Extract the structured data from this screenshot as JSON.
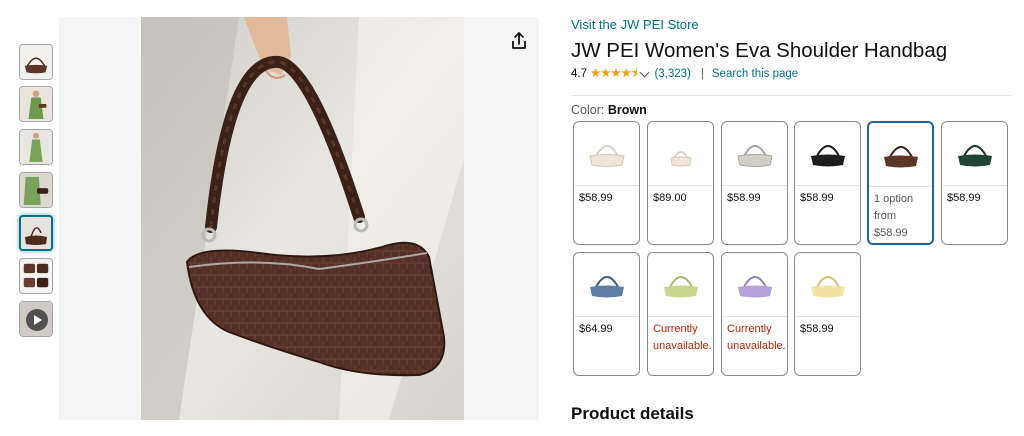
{
  "gallery": {
    "thumbnails": [
      {
        "icon": "handbag-thumbnail",
        "kind": "image"
      },
      {
        "icon": "model-green-dress-thumbnail",
        "kind": "image"
      },
      {
        "icon": "model-green-dress-side-thumbnail",
        "kind": "image"
      },
      {
        "icon": "model-holding-bag-thumbnail",
        "kind": "image"
      },
      {
        "icon": "handbag-hand-thumbnail",
        "kind": "image",
        "selected": true
      },
      {
        "icon": "handbag-details-thumbnail",
        "kind": "image"
      },
      {
        "icon": "video-play-thumbnail",
        "kind": "video"
      }
    ],
    "share_icon": "share-icon"
  },
  "product": {
    "store_link": "Visit the JW PEI Store",
    "title": "JW PEI Women's Eva Shoulder Handbag",
    "rating_value": "4.7",
    "stars": "★★★★⯨",
    "rating_count": "(3,323)",
    "separator": "|",
    "search_link": "Search this page"
  },
  "color": {
    "label": "Color:",
    "value": "Brown",
    "options": [
      {
        "name": "Cream",
        "price": "$58.99",
        "color": "#ece6da",
        "available": true
      },
      {
        "name": "Ivory Crystal",
        "price": "$89.00",
        "color": "#efe6d9",
        "available": true
      },
      {
        "name": "Light Grey",
        "price": "$58.99",
        "color": "#d4cfc6",
        "available": true
      },
      {
        "name": "Black",
        "price": "$58.99",
        "color": "#1e1e1e",
        "available": true
      },
      {
        "name": "Brown",
        "price_line1": "1 option",
        "price_line2": "from",
        "price_line3": "$58.99",
        "color": "#5c3526",
        "available": true,
        "selected": true
      },
      {
        "name": "Dark Green",
        "price": "$58.99",
        "color": "#214534",
        "available": true
      },
      {
        "name": "Denim Blue",
        "price": "$64.99",
        "color": "#5d7fa5",
        "available": true
      },
      {
        "name": "Light Green",
        "price_line1": "Currently",
        "price_line2": "unavailable.",
        "color": "#c7d68f",
        "available": false
      },
      {
        "name": "Lilac",
        "price_line1": "Currently",
        "price_line2": "unavailable.",
        "color": "#b6a1d8",
        "available": false
      },
      {
        "name": "Butter Yellow",
        "price": "$58.99",
        "color": "#f0e3a2",
        "available": true
      }
    ]
  },
  "section": {
    "product_details": "Product details"
  },
  "colors": {
    "link": "#007185",
    "star": "#ff9c00",
    "selected_border": "#2162a1",
    "unavailable": "#b12704"
  }
}
